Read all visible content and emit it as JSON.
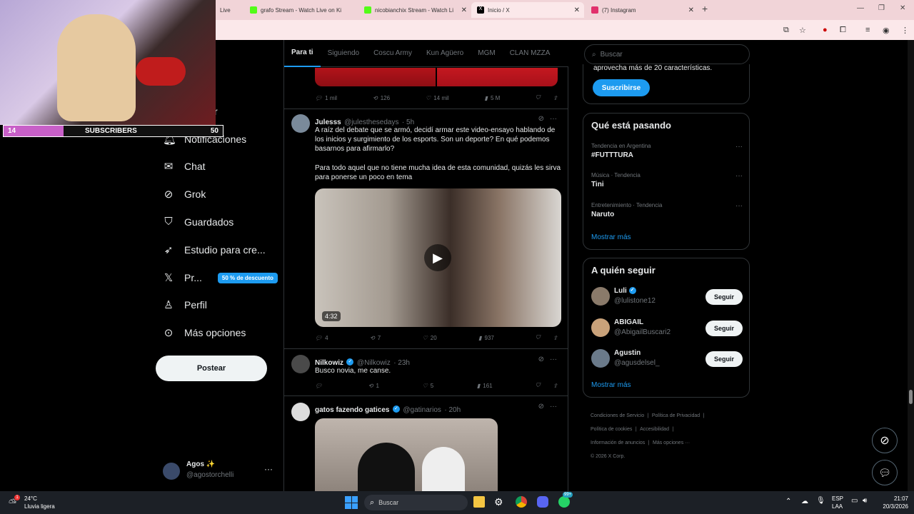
{
  "browser": {
    "tabs": [
      {
        "label": "Live",
        "active": false
      },
      {
        "label": "grafo Stream - Watch Live on Ki",
        "active": false
      },
      {
        "label": "nicobianchix Stream - Watch Li",
        "active": false
      },
      {
        "label": "Inicio / X",
        "active": true
      },
      {
        "label": "(7) Instagram",
        "active": false
      }
    ]
  },
  "sidebar": {
    "partial_label": "r",
    "items": [
      {
        "icon": "bell-icon",
        "label": "Notificaciones"
      },
      {
        "icon": "mail-icon",
        "label": "Chat"
      },
      {
        "icon": "grok-icon",
        "label": "Grok"
      },
      {
        "icon": "bookmark-icon",
        "label": "Guardados"
      },
      {
        "icon": "rocket-icon",
        "label": "Estudio para cre..."
      },
      {
        "icon": "x-logo-icon",
        "label": "Pr...",
        "badge": "50 % de descuento"
      },
      {
        "icon": "person-icon",
        "label": "Perfil"
      },
      {
        "icon": "more-circle-icon",
        "label": "Más opciones"
      }
    ],
    "post_button": "Postear",
    "account": {
      "name": "Agos ✨",
      "handle": "@agostorchelli"
    }
  },
  "feed": {
    "tabs": [
      "Para ti",
      "Siguiendo",
      "Coscu Army",
      "Kun Agüero",
      "MGM",
      "CLAN MZZA"
    ],
    "tweet0_actions": {
      "replies": "1 mil",
      "retweets": "126",
      "likes": "14 mil",
      "views": "5 M"
    },
    "tweet1": {
      "name": "Julesss",
      "handle": "@julesthesedays",
      "time": "· 5h",
      "text1": "A raíz del debate que se armó, decidí armar este video-ensayo hablando de los inicios y surgimiento de los esports. Son un deporte? En qué podemos basarnos para afirmarlo?",
      "text2": "Para todo aquel que no tiene mucha idea de esta comunidad, quizás les sirva para ponerse un poco en tema",
      "video_duration": "4:32",
      "replies": "4",
      "retweets": "7",
      "likes": "20",
      "views": "937"
    },
    "tweet2": {
      "name": "Nilkowiz",
      "handle": "@Nilkowiz",
      "time": "· 23h",
      "text": "Busco novia, me canse.",
      "replies": "",
      "retweets": "1",
      "likes": "5",
      "views": "161"
    },
    "tweet3": {
      "name": "gatos fazendo gatices",
      "handle": "@gatinarios",
      "time": "· 20h"
    }
  },
  "right": {
    "search_placeholder": "Buscar",
    "premium_text": "aprovecha más de 20 características.",
    "subscribe": "Suscribirse",
    "trends_title": "Qué está pasando",
    "trends": [
      {
        "context": "Tendencia en Argentina",
        "name": "#FUTTTURA"
      },
      {
        "context": "Música · Tendencia",
        "name": "Tini"
      },
      {
        "context": "Entretenimiento · Tendencia",
        "name": "Naruto"
      }
    ],
    "show_more": "Mostrar más",
    "who_title": "A quién seguir",
    "who": [
      {
        "name": "Luli",
        "handle": "@lulistone12",
        "verified": true
      },
      {
        "name": "ABIGAIL",
        "handle": "@AbigailBuscari2",
        "verified": false
      },
      {
        "name": "Agustin",
        "handle": "@agusdelsel_",
        "verified": false
      }
    ],
    "follow": "Seguir",
    "footer": [
      "Condiciones de Servicio",
      "Política de Privacidad",
      "Política de cookies",
      "Accesibilidad",
      "Información de anuncios",
      "Más opciones ···",
      "© 2026 X Corp."
    ]
  },
  "overlay": {
    "sub_count": "14",
    "sub_label": "SUBSCRIBERS",
    "sub_goal": "50"
  },
  "taskbar": {
    "weather_temp": "24°C",
    "weather_desc": "Lluvia ligera",
    "search": "Buscar",
    "lang1": "ESP",
    "lang2": "LAA",
    "time": "21:07",
    "date": "20/3/2026",
    "notif_badge": "1",
    "whatsapp_badge": "99+"
  }
}
